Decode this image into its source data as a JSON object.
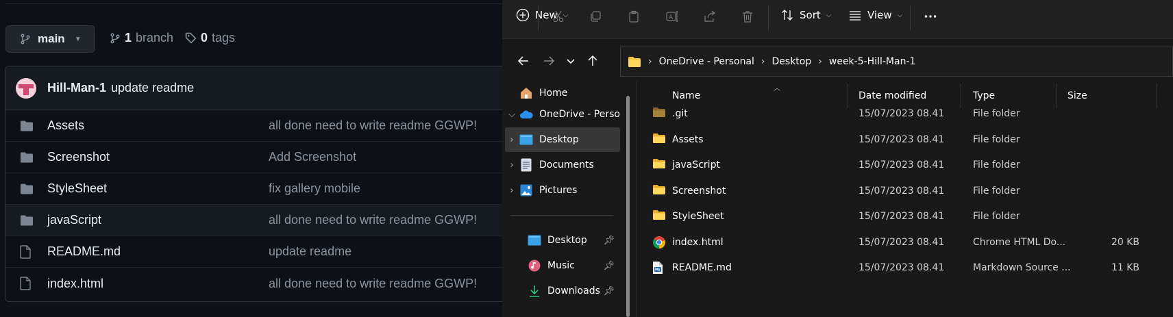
{
  "github": {
    "branch": {
      "name": "main"
    },
    "branches": {
      "count": "1",
      "label": "branch"
    },
    "tags": {
      "count": "0",
      "label": "tags"
    },
    "latest_commit": {
      "author": "Hill-Man-1",
      "message": "update readme"
    },
    "files": [
      {
        "name": "Assets",
        "type": "folder",
        "message": "all done need to write readme GGWP!"
      },
      {
        "name": "Screenshot",
        "type": "folder",
        "message": "Add Screenshot"
      },
      {
        "name": "StyleSheet",
        "type": "folder",
        "message": "fix gallery mobile"
      },
      {
        "name": "javaScript",
        "type": "folder",
        "message": "all done need to write readme GGWP!"
      },
      {
        "name": "README.md",
        "type": "file",
        "message": "update readme"
      },
      {
        "name": "index.html",
        "type": "file",
        "message": "all done need to write readme GGWP!"
      }
    ]
  },
  "explorer": {
    "toolbar": {
      "new_label": "New",
      "sort_label": "Sort",
      "view_label": "View"
    },
    "address": [
      "OneDrive - Personal",
      "Desktop",
      "week-5-Hill-Man-1"
    ],
    "nav": [
      {
        "label": "Home",
        "icon": "home-icon"
      },
      {
        "label": "OneDrive - Perso",
        "icon": "cloud-icon"
      },
      {
        "label": "Desktop",
        "icon": "desktop-icon"
      },
      {
        "label": "Documents",
        "icon": "documents-icon"
      },
      {
        "label": "Pictures",
        "icon": "pictures-icon"
      }
    ],
    "quick_access": [
      {
        "label": "Desktop",
        "icon": "desktop-icon"
      },
      {
        "label": "Music",
        "icon": "music-icon"
      },
      {
        "label": "Downloads",
        "icon": "downloads-icon"
      }
    ],
    "columns": {
      "name": "Name",
      "date": "Date modified",
      "type": "Type",
      "size": "Size"
    },
    "files": [
      {
        "name": ".git",
        "date": "15/07/2023 08.41",
        "type": "File folder",
        "size": "",
        "icon": "git-folder-icon"
      },
      {
        "name": "Assets",
        "date": "15/07/2023 08.41",
        "type": "File folder",
        "size": "",
        "icon": "folder-icon"
      },
      {
        "name": "javaScript",
        "date": "15/07/2023 08.41",
        "type": "File folder",
        "size": "",
        "icon": "folder-icon"
      },
      {
        "name": "Screenshot",
        "date": "15/07/2023 08.41",
        "type": "File folder",
        "size": "",
        "icon": "folder-icon"
      },
      {
        "name": "StyleSheet",
        "date": "15/07/2023 08.41",
        "type": "File folder",
        "size": "",
        "icon": "folder-icon"
      },
      {
        "name": "index.html",
        "date": "15/07/2023 08.41",
        "type": "Chrome HTML Do...",
        "size": "20 KB",
        "icon": "chrome-icon"
      },
      {
        "name": "README.md",
        "date": "15/07/2023 08.41",
        "type": "Markdown Source ...",
        "size": "11 KB",
        "icon": "markdown-icon"
      }
    ]
  },
  "colors": {
    "gh_bg": "#0d1117",
    "gh_border": "#30363d",
    "gh_muted": "#8b949e",
    "explorer_bg": "#191919",
    "folder_yellow": "#f8c84a",
    "selection": "#373737"
  }
}
